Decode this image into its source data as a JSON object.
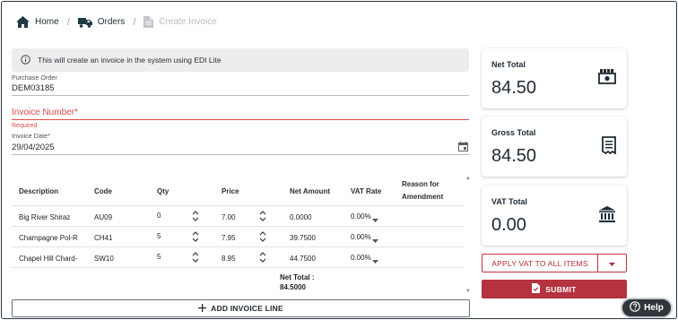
{
  "breadcrumb": {
    "home": "Home",
    "orders": "Orders",
    "current": "Create Invoice"
  },
  "info": {
    "text": "This will create an invoice in the system using EDI Lite",
    "icon": "info-icon"
  },
  "form": {
    "purchase_order_label": "Purchase Order",
    "purchase_order_value": "DEM03185",
    "invoice_number_label": "Invoice Number*",
    "invoice_number_value": "",
    "invoice_number_error": "Required",
    "invoice_date_label": "Invoice Date*",
    "invoice_date_value": "29/04/2025"
  },
  "table": {
    "headers": {
      "description": "Description",
      "code": "Code",
      "qty": "Qty",
      "price": "Price",
      "net_amount": "Net Amount",
      "vat_rate": "VAT Rate",
      "reason_line1": "Reason for",
      "reason_line2": "Amendment"
    },
    "rows": [
      {
        "description": "Big River Shiraz",
        "code": "AU09",
        "qty": "0",
        "price": "7.00",
        "net_amount": "0.0000",
        "vat_rate": "0.00%"
      },
      {
        "description": "Champagne Pol-R",
        "code": "CH41",
        "qty": "5",
        "price": "7.95",
        "net_amount": "39.7500",
        "vat_rate": "0.00%"
      },
      {
        "description": "Chapel Hill Chard-",
        "code": "SW10",
        "qty": "5",
        "price": "8.95",
        "net_amount": "44.7500",
        "vat_rate": "0.00%"
      }
    ],
    "net_total_label": "Net Total :",
    "net_total_value": "84.5000",
    "add_line_label": "ADD INVOICE LINE"
  },
  "totals": {
    "net_title": "Net Total",
    "net_value": "84.50",
    "gross_title": "Gross Total",
    "gross_value": "84.50",
    "vat_title": "VAT Total",
    "vat_value": "0.00"
  },
  "actions": {
    "apply_vat_label": "APPLY VAT TO ALL ITEMS",
    "submit_label": "SUBMIT",
    "help_label": "Help"
  },
  "colors": {
    "accent": "#b5323f",
    "error": "#e24a4a",
    "dark": "#1f2a33"
  }
}
